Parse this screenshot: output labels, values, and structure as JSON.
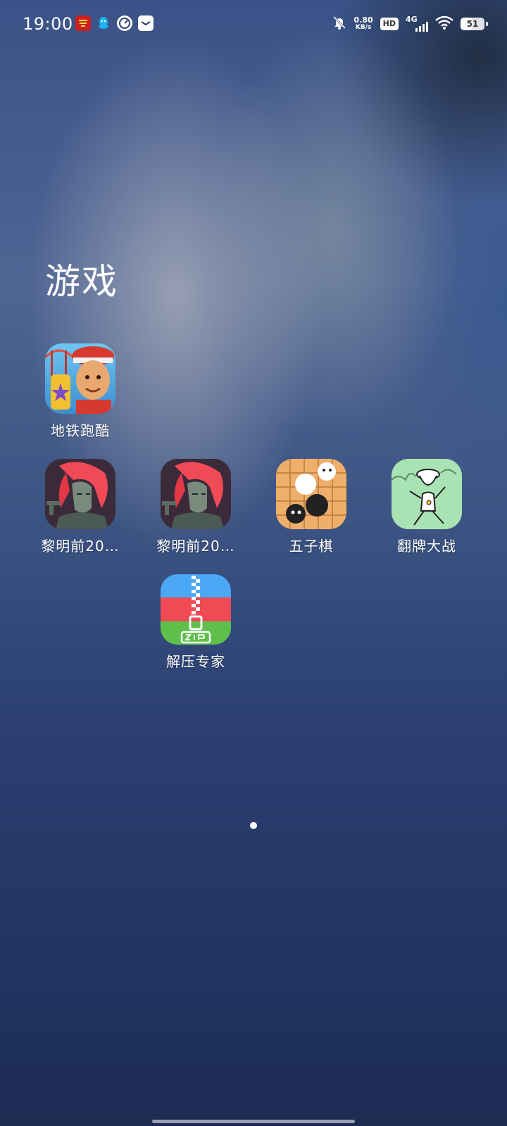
{
  "status_bar": {
    "time": "19:00",
    "net_speed_value": "0.80",
    "net_speed_unit": "KB/s",
    "hd": "HD",
    "network": "4G",
    "battery": "51",
    "battery_level": 0.51,
    "icons": [
      "news-app-icon",
      "qq-icon",
      "speedometer-icon",
      "mail-icon",
      "mute-bell-icon",
      "wifi-icon"
    ]
  },
  "folder": {
    "title": "游戏",
    "apps": [
      {
        "label": "地铁跑酷",
        "icon": "subway-surfers-icon"
      },
      {
        "label": "黎明前20…",
        "icon": "dawn-game-icon"
      },
      {
        "label": "黎明前20…",
        "icon": "dawn-game-icon"
      },
      {
        "label": "五子棋",
        "icon": "gomoku-icon"
      },
      {
        "label": "翻牌大战",
        "icon": "card-flip-icon"
      },
      {
        "label": "解压专家",
        "icon": "zip-icon"
      }
    ]
  },
  "pager": {
    "pages": 1,
    "current": 1
  }
}
